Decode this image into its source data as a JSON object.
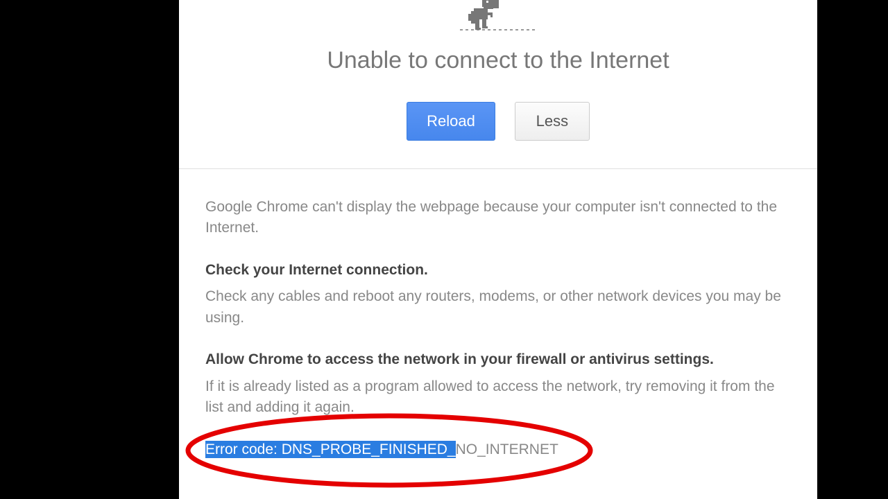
{
  "heading": "Unable to connect to the Internet",
  "buttons": {
    "reload": "Reload",
    "less": "Less"
  },
  "description": "Google Chrome can't display the webpage because your computer isn't connected to the Internet.",
  "sections": [
    {
      "title": "Check your Internet connection.",
      "body": "Check any cables and reboot any routers, modems, or other network devices you may be using."
    },
    {
      "title": "Allow Chrome to access the network in your firewall or antivirus settings.",
      "body": "If it is already listed as a program allowed to access the network, try removing it from the list and adding it again."
    }
  ],
  "error_code": {
    "selected": "Error code: DNS_PROBE_FINISHED_",
    "rest": "NO_INTERNET"
  }
}
